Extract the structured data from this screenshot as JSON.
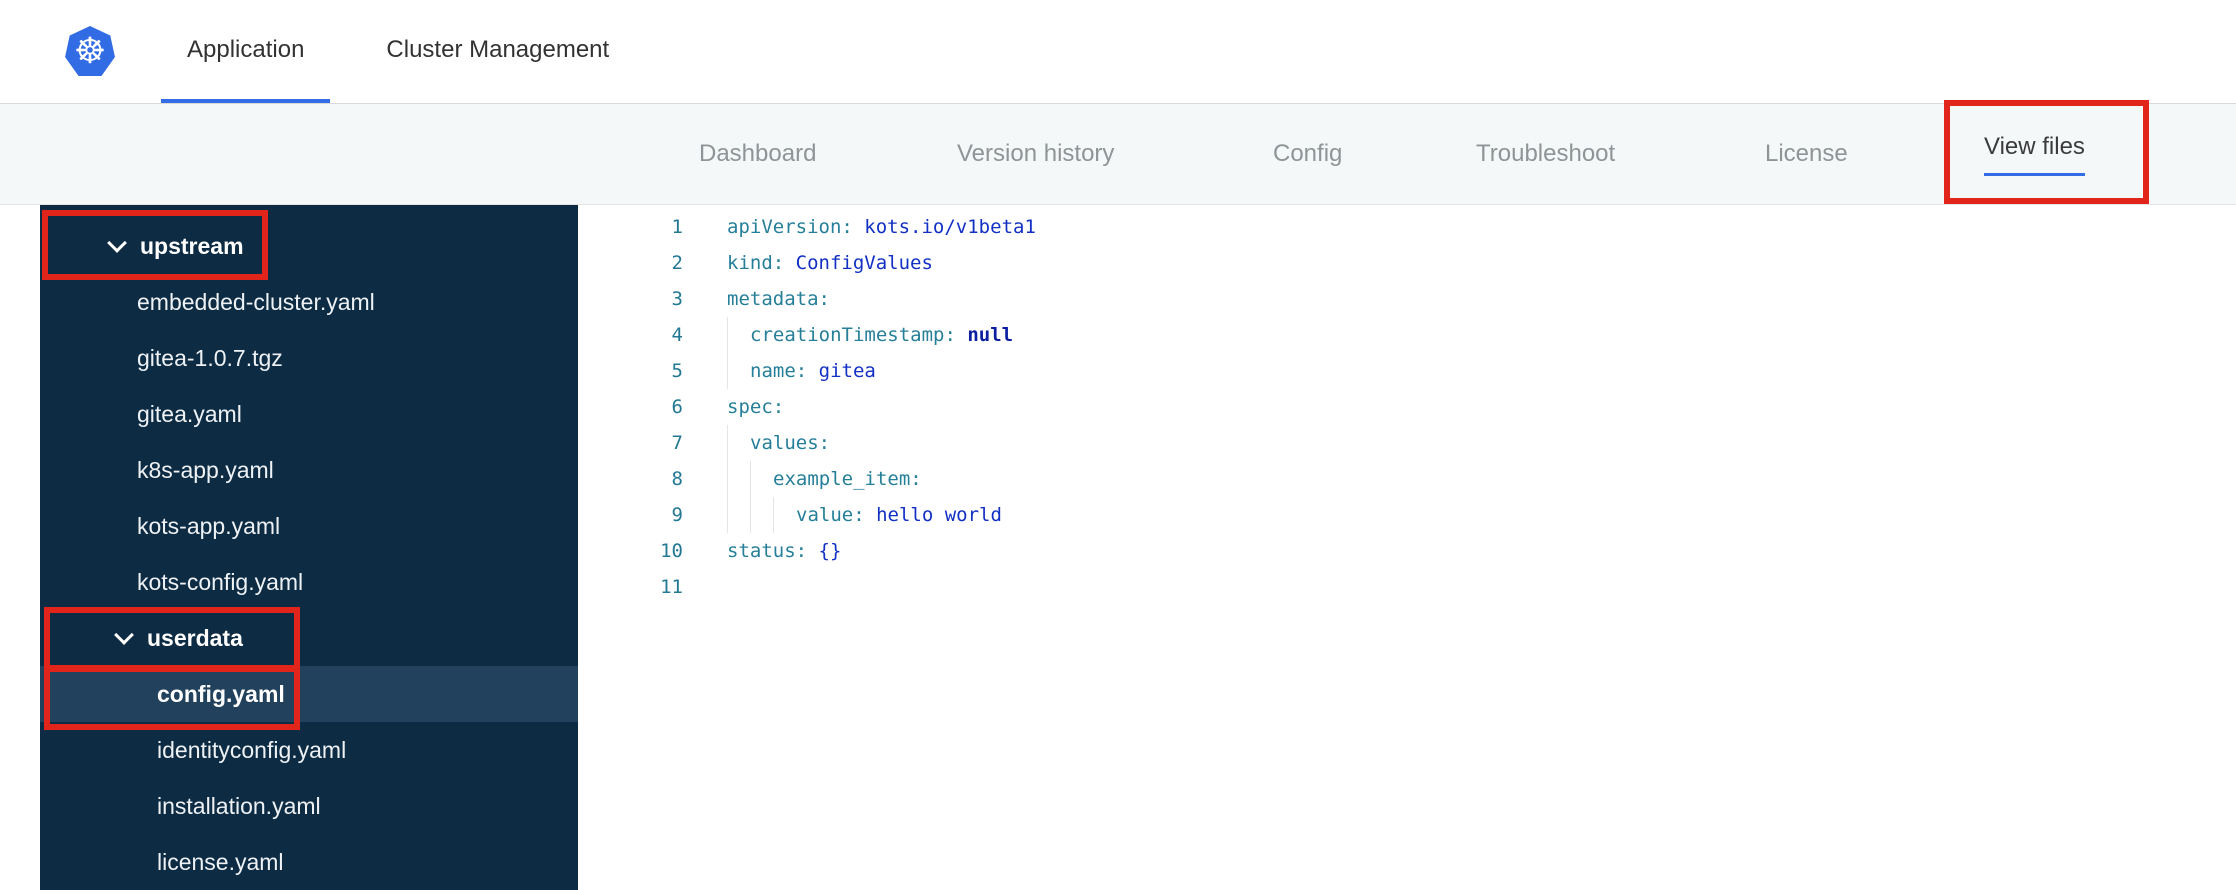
{
  "topbar": {
    "logo": "kubernetes-logo",
    "tabs": [
      {
        "label": "Application",
        "active": true
      },
      {
        "label": "Cluster Management",
        "active": false
      }
    ]
  },
  "subnav": {
    "items": [
      {
        "label": "Dashboard",
        "active": false
      },
      {
        "label": "Version history",
        "active": false
      },
      {
        "label": "Config",
        "active": false
      },
      {
        "label": "Troubleshoot",
        "active": false
      },
      {
        "label": "License",
        "active": false
      },
      {
        "label": "View files",
        "active": true
      }
    ]
  },
  "file_tree": {
    "items": [
      {
        "kind": "folder",
        "label": "upstream",
        "level": 0,
        "expanded": true,
        "selected": false
      },
      {
        "kind": "file",
        "label": "embedded-cluster.yaml",
        "level": 0,
        "selected": false
      },
      {
        "kind": "file",
        "label": "gitea-1.0.7.tgz",
        "level": 0,
        "selected": false
      },
      {
        "kind": "file",
        "label": "gitea.yaml",
        "level": 0,
        "selected": false
      },
      {
        "kind": "file",
        "label": "k8s-app.yaml",
        "level": 0,
        "selected": false
      },
      {
        "kind": "file",
        "label": "kots-app.yaml",
        "level": 0,
        "selected": false
      },
      {
        "kind": "file",
        "label": "kots-config.yaml",
        "level": 0,
        "selected": false
      },
      {
        "kind": "folder",
        "label": "userdata",
        "level": 1,
        "expanded": true,
        "selected": false
      },
      {
        "kind": "file",
        "label": "config.yaml",
        "level": 1,
        "selected": true
      },
      {
        "kind": "file",
        "label": "identityconfig.yaml",
        "level": 1,
        "selected": false
      },
      {
        "kind": "file",
        "label": "installation.yaml",
        "level": 1,
        "selected": false
      },
      {
        "kind": "file",
        "label": "license.yaml",
        "level": 1,
        "selected": false
      }
    ]
  },
  "editor": {
    "file": "config.yaml",
    "lines": [
      {
        "n": 1,
        "g": 0,
        "tok": [
          [
            "key",
            "apiVersion:"
          ],
          [
            "txt",
            " "
          ],
          [
            "val",
            "kots.io/v1beta1"
          ]
        ]
      },
      {
        "n": 2,
        "g": 0,
        "tok": [
          [
            "key",
            "kind:"
          ],
          [
            "txt",
            " "
          ],
          [
            "val",
            "ConfigValues"
          ]
        ]
      },
      {
        "n": 3,
        "g": 0,
        "tok": [
          [
            "key",
            "metadata:"
          ]
        ]
      },
      {
        "n": 4,
        "g": 1,
        "tok": [
          [
            "key",
            "creationTimestamp:"
          ],
          [
            "txt",
            " "
          ],
          [
            "kw",
            "null"
          ]
        ]
      },
      {
        "n": 5,
        "g": 1,
        "tok": [
          [
            "key",
            "name:"
          ],
          [
            "txt",
            " "
          ],
          [
            "val",
            "gitea"
          ]
        ]
      },
      {
        "n": 6,
        "g": 0,
        "tok": [
          [
            "key",
            "spec:"
          ]
        ]
      },
      {
        "n": 7,
        "g": 1,
        "tok": [
          [
            "key",
            "values:"
          ]
        ]
      },
      {
        "n": 8,
        "g": 2,
        "tok": [
          [
            "key",
            "example_item:"
          ]
        ]
      },
      {
        "n": 9,
        "g": 3,
        "tok": [
          [
            "key",
            "value:"
          ],
          [
            "txt",
            " "
          ],
          [
            "val",
            "hello world"
          ]
        ]
      },
      {
        "n": 10,
        "g": 0,
        "tok": [
          [
            "key",
            "status:"
          ],
          [
            "txt",
            " "
          ],
          [
            "val",
            "{}"
          ]
        ]
      },
      {
        "n": 11,
        "g": 0,
        "tok": []
      }
    ]
  },
  "annotations": {
    "boxes": [
      "upstream-folder",
      "userdata-folder",
      "config-yaml-file",
      "view-files-tab"
    ]
  },
  "colors": {
    "accent_blue": "#326de6",
    "kubernetes_blue": "#326ce5",
    "sidebar_bg": "#0d2b43",
    "selected_row_bg": "#21415c",
    "annotation_red": "#e1251b",
    "yaml_key": "#267f99",
    "yaml_value": "#1230c4",
    "yaml_keyword": "#0b1fa0",
    "line_number": "#237893"
  }
}
